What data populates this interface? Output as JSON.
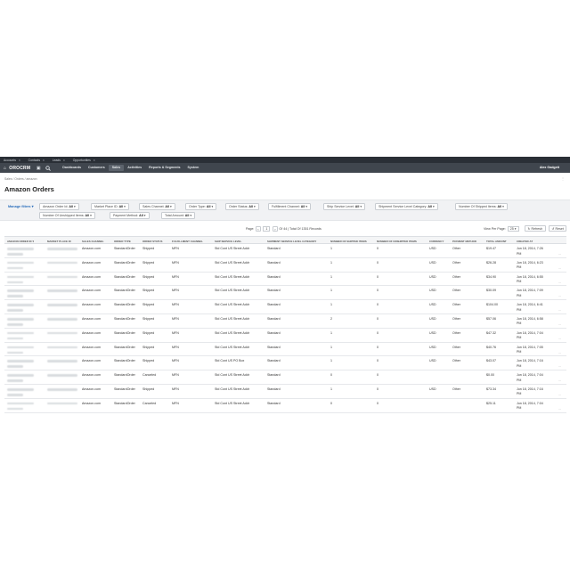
{
  "pinbar": {
    "pins": [
      "Accounts",
      "Contacts",
      "Leads",
      "Opportunities"
    ],
    "close_glyph": "x"
  },
  "nav": {
    "logo": "OROCRM",
    "logo_icon": "home-icon",
    "menu": [
      "Dashboards",
      "Customers",
      "Sales",
      "Activities",
      "Reports & Segments",
      "System"
    ],
    "active_index": 2,
    "user": "Alex Gadgett"
  },
  "breadcrumb": "Sales / Orders / amazon",
  "page_title": "Amazon Orders",
  "filters": {
    "manage_label": "Manage filters",
    "chips": [
      {
        "label": "Amazon Order Id:",
        "value": "All"
      },
      {
        "label": "Market Place ID:",
        "value": "All"
      },
      {
        "label": "Sales Channel:",
        "value": "All"
      },
      {
        "label": "Order Type:",
        "value": "All"
      },
      {
        "label": "Order Status:",
        "value": "All"
      },
      {
        "label": "Fulfillment Channel:",
        "value": "All"
      },
      {
        "label": "Ship Service Level:",
        "value": "All"
      },
      {
        "label": "Shipment Service Level Category:",
        "value": "All"
      },
      {
        "label": "Number Of Shipped Items:",
        "value": "All"
      },
      {
        "label": "Number Of Unshipped Items:",
        "value": "All"
      },
      {
        "label": "Payment Method:",
        "value": "All"
      },
      {
        "label": "Total Amount:",
        "value": "All"
      }
    ]
  },
  "pager": {
    "label": "Page:",
    "page": "1",
    "summary": "Of 44 | Total Of 1351 Records"
  },
  "view_per_page": {
    "label": "View Per Page:",
    "value": "25"
  },
  "toolbar": {
    "refresh": "Refresh",
    "reset": "Reset"
  },
  "columns": [
    "Amazon Order Id",
    "Market Place ID",
    "Sales Channel",
    "Order Type",
    "Order Status",
    "Fulfillment Channel",
    "Ship Service Level",
    "Shipment Service Level Category",
    "Number Of Shipped Items",
    "Number Of Unshipped Items",
    "Currency",
    "Payment Method",
    "Total Amount",
    "Created At"
  ],
  "rows": [
    {
      "channel": "Amazon.com",
      "type": "StandardOrder",
      "status": "Shipped",
      "fulfillment": "MFN",
      "ship_level": "Std Cont US Street Addr",
      "category": "Standard",
      "shipped": "1",
      "unshipped": "0",
      "currency": "USD",
      "payment": "Other",
      "total": "$19.47",
      "created": "Jun 18, 2014, 7:26",
      "created2": "PM"
    },
    {
      "channel": "Amazon.com",
      "type": "StandardOrder",
      "status": "Shipped",
      "fulfillment": "MFN",
      "ship_level": "Std Cont US Street Addr",
      "category": "Standard",
      "shipped": "1",
      "unshipped": "0",
      "currency": "USD",
      "payment": "Other",
      "total": "$26.28",
      "created": "Jun 18, 2014, 6:23",
      "created2": "PM"
    },
    {
      "channel": "Amazon.com",
      "type": "StandardOrder",
      "status": "Shipped",
      "fulfillment": "MFN",
      "ship_level": "Std Cont US Street Addr",
      "category": "Standard",
      "shipped": "1",
      "unshipped": "0",
      "currency": "USD",
      "payment": "Other",
      "total": "$34.90",
      "created": "Jun 18, 2014, 6:55",
      "created2": "PM"
    },
    {
      "channel": "Amazon.com",
      "type": "StandardOrder",
      "status": "Shipped",
      "fulfillment": "MFN",
      "ship_level": "Std Cont US Street Addr",
      "category": "Standard",
      "shipped": "1",
      "unshipped": "0",
      "currency": "USD",
      "payment": "Other",
      "total": "$30.09",
      "created": "Jun 18, 2014, 7:09",
      "created2": "PM"
    },
    {
      "channel": "Amazon.com",
      "type": "StandardOrder",
      "status": "Shipped",
      "fulfillment": "MFN",
      "ship_level": "Std Cont US Street Addr",
      "category": "Standard",
      "shipped": "1",
      "unshipped": "0",
      "currency": "USD",
      "payment": "Other",
      "total": "$104.00",
      "created": "Jun 18, 2014, 6:41",
      "created2": "PM"
    },
    {
      "channel": "Amazon.com",
      "type": "StandardOrder",
      "status": "Shipped",
      "fulfillment": "MFN",
      "ship_level": "Std Cont US Street Addr",
      "category": "Standard",
      "shipped": "2",
      "unshipped": "0",
      "currency": "USD",
      "payment": "Other",
      "total": "$57.06",
      "created": "Jun 18, 2014, 6:58",
      "created2": "PM"
    },
    {
      "channel": "Amazon.com",
      "type": "StandardOrder",
      "status": "Shipped",
      "fulfillment": "MFN",
      "ship_level": "Std Cont US Street Addr",
      "category": "Standard",
      "shipped": "1",
      "unshipped": "0",
      "currency": "USD",
      "payment": "Other",
      "total": "$47.32",
      "created": "Jun 18, 2014, 7:04",
      "created2": "PM"
    },
    {
      "channel": "Amazon.com",
      "type": "StandardOrder",
      "status": "Shipped",
      "fulfillment": "MFN",
      "ship_level": "Std Cont US Street Addr",
      "category": "Standard",
      "shipped": "1",
      "unshipped": "0",
      "currency": "USD",
      "payment": "Other",
      "total": "$40.76",
      "created": "Jun 18, 2014, 7:05",
      "created2": "PM"
    },
    {
      "channel": "Amazon.com",
      "type": "StandardOrder",
      "status": "Shipped",
      "fulfillment": "MFN",
      "ship_level": "Std Cont US PO Box",
      "category": "Standard",
      "shipped": "1",
      "unshipped": "0",
      "currency": "USD",
      "payment": "Other",
      "total": "$43.07",
      "created": "Jun 18, 2014, 7:16",
      "created2": "PM"
    },
    {
      "channel": "Amazon.com",
      "type": "StandardOrder",
      "status": "Canceled",
      "fulfillment": "MFN",
      "ship_level": "Std Cont US Street Addr",
      "category": "Standard",
      "shipped": "0",
      "unshipped": "0",
      "currency": "",
      "payment": "",
      "total": "$0.00",
      "created": "Jun 18, 2014, 7:04",
      "created2": "PM"
    },
    {
      "channel": "Amazon.com",
      "type": "StandardOrder",
      "status": "Shipped",
      "fulfillment": "MFN",
      "ship_level": "Std Cont US Street Addr",
      "category": "Standard",
      "shipped": "1",
      "unshipped": "0",
      "currency": "USD",
      "payment": "Other",
      "total": "$73.34",
      "created": "Jun 18, 2014, 7:16",
      "created2": "PM"
    },
    {
      "channel": "Amazon.com",
      "type": "StandardOrder",
      "status": "Canceled",
      "fulfillment": "MFN",
      "ship_level": "Std Cont US Street Addr",
      "category": "Standard",
      "shipped": "0",
      "unshipped": "0",
      "currency": "",
      "payment": "",
      "total": "$25.11",
      "created": "Jun 18, 2014, 7:04",
      "created2": "PM"
    }
  ],
  "row_action_glyph": "..."
}
